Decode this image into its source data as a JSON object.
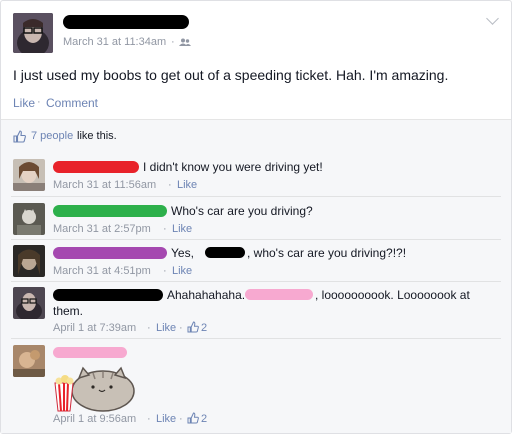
{
  "post": {
    "timestamp": "March 31 at 11:34am",
    "audience_icon": "friends-icon",
    "text": "I just used my boobs to get out of a speeding ticket. Hah. I'm amazing.",
    "like_label": "Like",
    "comment_label": "Comment",
    "dot": "·"
  },
  "likes": {
    "count_text": "7 people",
    "suffix": " like this."
  },
  "comments": [
    {
      "text": "I didn't know you were driving yet!",
      "timestamp": "March 31 at 11:56am",
      "like_label": "Like",
      "name_color": "#e8222a"
    },
    {
      "text": "Who's car are you driving?",
      "timestamp": "March 31 at 2:57pm",
      "like_label": "Like",
      "name_color": "#2db04b"
    },
    {
      "text_a": "Yes,",
      "text_b": ", who's car are you driving?!?!",
      "timestamp": "March 31 at 4:51pm",
      "like_label": "Like",
      "name_color": "#a548b0"
    },
    {
      "text_a": "Ahahahahaha.",
      "text_b": ", loooooooook. Loooooook at",
      "text_c": "them.",
      "timestamp": "April 1 at 7:39am",
      "like_label": "Like",
      "like_count": "2",
      "name_color": "#000000",
      "mention_color": "#f7a9d0"
    },
    {
      "timestamp": "April 1 at 9:56am",
      "like_label": "Like",
      "like_count": "2",
      "name_color": "#f7a9d0",
      "sticker": "pusheen-popcorn-sticker"
    }
  ],
  "colors": {
    "link": "#6d84b4",
    "meta": "#9197a3",
    "text": "#141823",
    "redaction": "#000000"
  }
}
